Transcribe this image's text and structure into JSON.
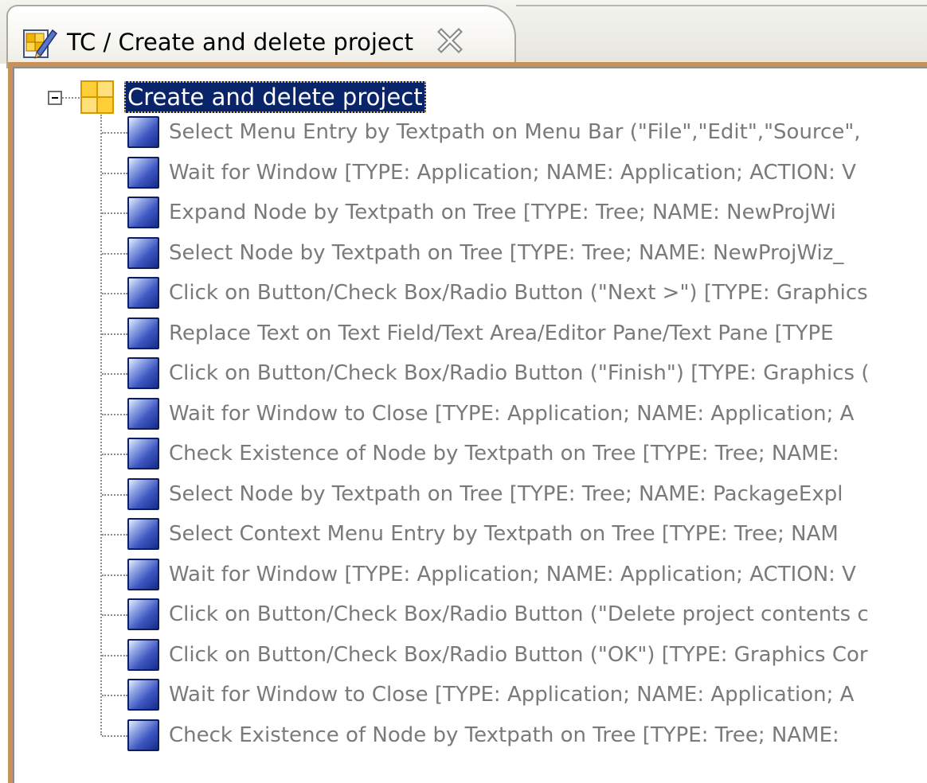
{
  "tab": {
    "title": "TC / Create and delete project",
    "icon": "testcase-edit-icon",
    "close_icon": "close-icon"
  },
  "colors": {
    "frame_border": "#c7925a",
    "selection_bg": "#0a246a",
    "step_text": "#7a7a7a",
    "step_icon": "#3e57c2"
  },
  "tree": {
    "root": {
      "label": "Create and delete project",
      "icon": "testsuite-icon",
      "expanded": true,
      "selected": true
    },
    "steps": [
      {
        "label": "Select Menu Entry by Textpath on Menu Bar (\"File\",\"Edit\",\"Source\",",
        "icon": "teststep-icon"
      },
      {
        "label": "Wait for Window [TYPE: Application; NAME: Application; ACTION: V",
        "icon": "teststep-icon"
      },
      {
        "label": "Expand Node by Textpath on Tree [TYPE: Tree; NAME: NewProjWi",
        "icon": "teststep-icon"
      },
      {
        "label": "Select Node by Textpath on Tree [TYPE: Tree; NAME: NewProjWiz_",
        "icon": "teststep-icon"
      },
      {
        "label": "Click on Button/Check Box/Radio Button (\"Next >\") [TYPE: Graphics",
        "icon": "teststep-icon"
      },
      {
        "label": "Replace Text on Text Field/Text Area/Editor Pane/Text Pane [TYPE",
        "icon": "teststep-icon"
      },
      {
        "label": "Click on Button/Check Box/Radio Button (\"Finish\") [TYPE: Graphics (",
        "icon": "teststep-icon"
      },
      {
        "label": "Wait for Window to Close [TYPE: Application; NAME: Application; A",
        "icon": "teststep-icon"
      },
      {
        "label": "Check Existence of Node by Textpath on Tree [TYPE: Tree; NAME:",
        "icon": "teststep-icon"
      },
      {
        "label": "Select Node by Textpath on Tree [TYPE: Tree; NAME: PackageExpl",
        "icon": "teststep-icon"
      },
      {
        "label": "Select Context Menu Entry by Textpath on Tree [TYPE: Tree; NAM",
        "icon": "teststep-icon"
      },
      {
        "label": "Wait for Window [TYPE: Application; NAME: Application; ACTION: V",
        "icon": "teststep-icon"
      },
      {
        "label": "Click on Button/Check Box/Radio Button (\"Delete project contents c",
        "icon": "teststep-icon"
      },
      {
        "label": "Click on Button/Check Box/Radio Button (\"OK\") [TYPE: Graphics Cor",
        "icon": "teststep-icon"
      },
      {
        "label": "Wait for Window to Close [TYPE: Application; NAME: Application; A",
        "icon": "teststep-icon"
      },
      {
        "label": "Check Existence of Node by Textpath on Tree [TYPE: Tree; NAME:",
        "icon": "teststep-icon"
      }
    ]
  }
}
